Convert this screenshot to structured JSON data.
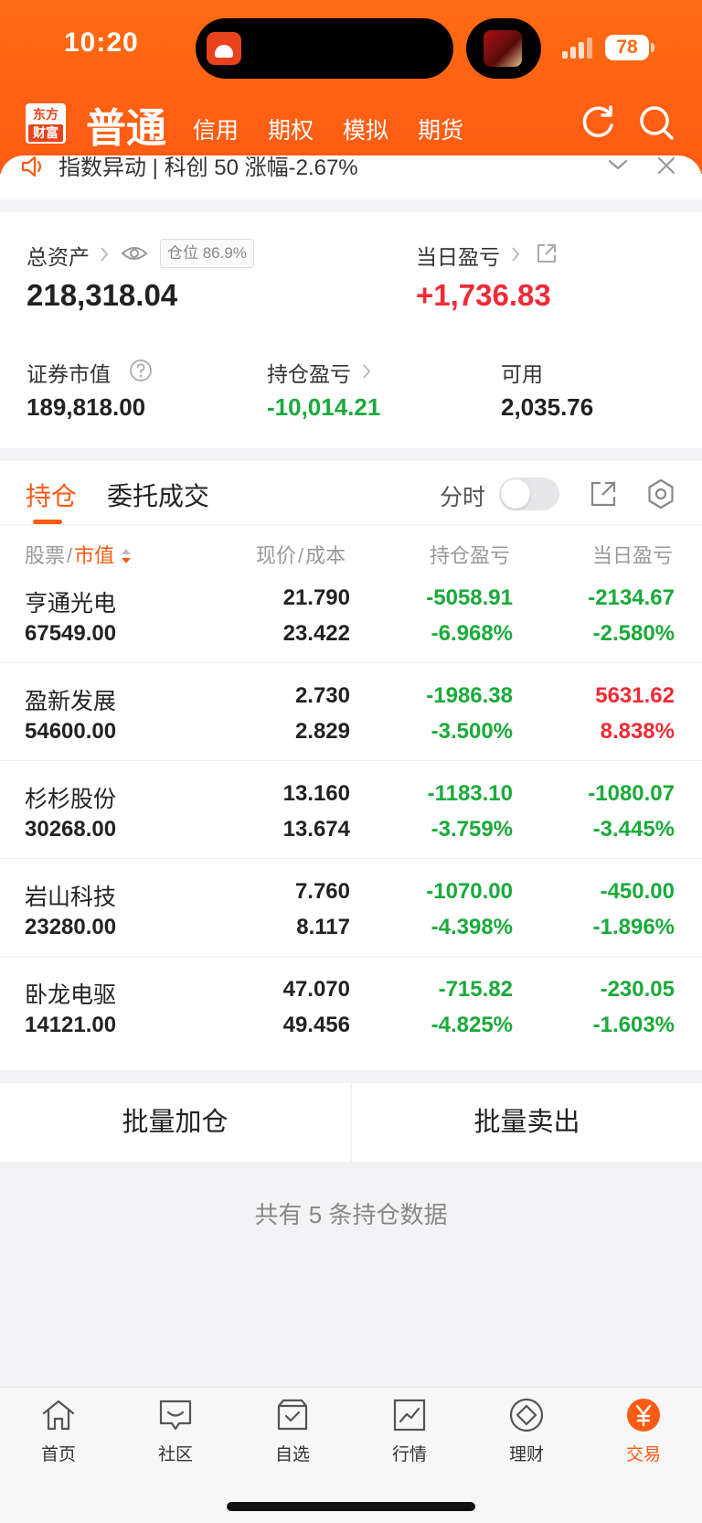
{
  "status": {
    "time": "10:20",
    "battery": "78"
  },
  "header": {
    "logo_line1": "东方",
    "logo_line2": "财富",
    "main_tab": "普通",
    "tabs": [
      "信用",
      "期权",
      "模拟",
      "期货"
    ]
  },
  "notice": {
    "text": "指数异动 | 科创 50 涨幅-2.67%"
  },
  "account": {
    "total_assets_label": "总资产",
    "total_assets_value": "218,318.04",
    "position_badge": "仓位 86.9%",
    "daily_pl_label": "当日盈亏",
    "daily_pl_value": "+1,736.83",
    "market_value_label": "证券市值",
    "market_value": "189,818.00",
    "holding_pl_label": "持仓盈亏",
    "holding_pl_value": "-10,014.21",
    "available_label": "可用",
    "available_value": "2,035.76"
  },
  "tabs": {
    "holdings": "持仓",
    "orders": "委托成交",
    "intraday": "分时"
  },
  "table": {
    "headers": {
      "stock": "股票",
      "sep": "/",
      "market_value": "市值",
      "price": "现价",
      "sep2": "/",
      "cost": "成本",
      "holding_pl": "持仓盈亏",
      "daily_pl": "当日盈亏"
    },
    "rows": [
      {
        "name": "亨通光电",
        "mv": "67549.00",
        "price": "21.790",
        "cost": "23.422",
        "hpl": "-5058.91",
        "hpct": "-6.968%",
        "dpl": "-2134.67",
        "dpct": "-2.580%"
      },
      {
        "name": "盈新发展",
        "mv": "54600.00",
        "price": "2.730",
        "cost": "2.829",
        "hpl": "-1986.38",
        "hpct": "-3.500%",
        "dpl": "5631.62",
        "dpct": "8.838%"
      },
      {
        "name": "杉杉股份",
        "mv": "30268.00",
        "price": "13.160",
        "cost": "13.674",
        "hpl": "-1183.10",
        "hpct": "-3.759%",
        "dpl": "-1080.07",
        "dpct": "-3.445%"
      },
      {
        "name": "岩山科技",
        "mv": "23280.00",
        "price": "7.760",
        "cost": "8.117",
        "hpl": "-1070.00",
        "hpct": "-4.398%",
        "dpl": "-450.00",
        "dpct": "-1.896%"
      },
      {
        "name": "卧龙电驱",
        "mv": "14121.00",
        "price": "47.070",
        "cost": "49.456",
        "hpl": "-715.82",
        "hpct": "-4.825%",
        "dpl": "-230.05",
        "dpct": "-1.603%"
      }
    ]
  },
  "buttons": {
    "batch_add": "批量加仓",
    "batch_sell": "批量卖出"
  },
  "summary": "共有 5 条持仓数据",
  "bottom_nav": [
    "首页",
    "社区",
    "自选",
    "行情",
    "理财",
    "交易"
  ],
  "colors": {
    "brand": "#ff5a14",
    "up": "#ef2b36",
    "down": "#1aaa3a"
  }
}
